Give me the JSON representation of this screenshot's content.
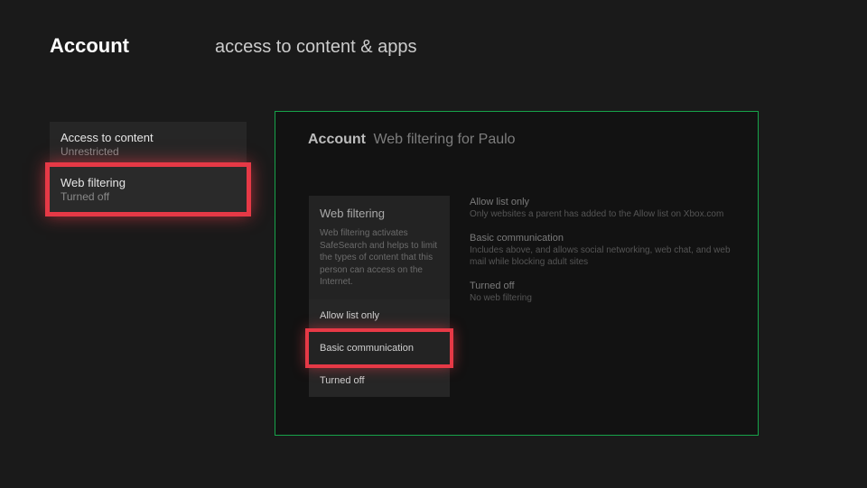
{
  "header": {
    "title": "Account",
    "subtitle": "access to content & apps"
  },
  "sidebar": {
    "items": [
      {
        "label": "Access to content",
        "value": "Unrestricted"
      },
      {
        "label": "Web filtering",
        "value": "Turned off"
      }
    ]
  },
  "detail": {
    "header_title": "Account",
    "header_sub": "Web filtering for Paulo",
    "intro": {
      "title": "Web filtering",
      "desc": "Web filtering activates SafeSearch and helps to limit the types of content that this person can access on the Internet."
    },
    "options": [
      {
        "label": "Allow list only"
      },
      {
        "label": "Basic communication"
      },
      {
        "label": "Turned off"
      }
    ],
    "option_descs": [
      {
        "title": "Allow list only",
        "body": "Only websites a parent has added to the Allow list on Xbox.com"
      },
      {
        "title": "Basic communication",
        "body": "Includes above, and allows social networking, web chat, and web mail while blocking adult sites"
      },
      {
        "title": "Turned off",
        "body": "No web filtering"
      }
    ]
  }
}
